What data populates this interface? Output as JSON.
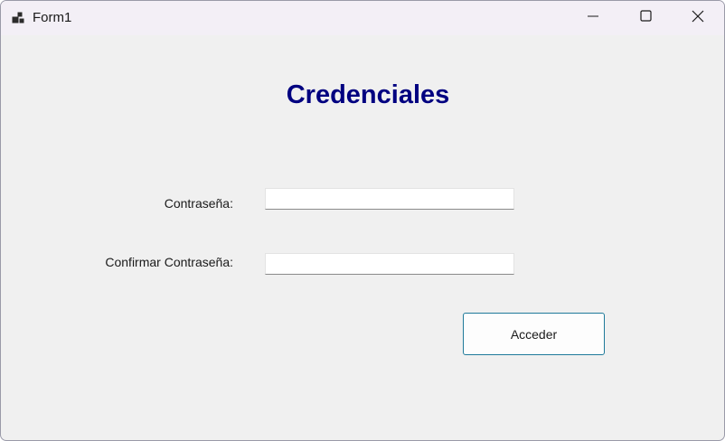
{
  "window": {
    "title": "Form1",
    "icon": "app-form-icon",
    "controls": {
      "minimize_icon": "minimize-icon",
      "maximize_icon": "maximize-icon",
      "close_icon": "close-icon"
    }
  },
  "form": {
    "heading": "Credenciales",
    "heading_color": "#000080",
    "password_label": "Contraseña:",
    "password_value": "",
    "confirm_label": "Confirmar Contraseña:",
    "confirm_value": "",
    "submit_label": "Acceder",
    "submit_border_color": "#1f7a9a"
  }
}
